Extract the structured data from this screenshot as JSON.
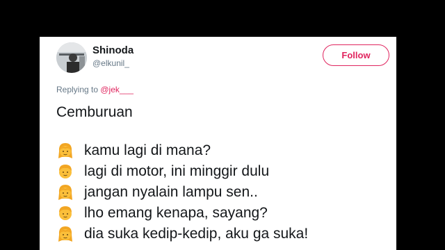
{
  "tweet": {
    "author_name": "Shinoda",
    "author_handle": "@elkunil_",
    "follow_label": "Follow",
    "reply_prefix": "Replying to ",
    "reply_to": "@jek___",
    "title": "Cemburuan",
    "lines": [
      {
        "emoji": "girl-emoji",
        "text": "kamu lagi di mana?"
      },
      {
        "emoji": "boy-emoji",
        "text": "lagi di motor, ini minggir dulu"
      },
      {
        "emoji": "girl-emoji",
        "text": "jangan nyalain lampu sen.."
      },
      {
        "emoji": "boy-emoji",
        "text": "lho emang kenapa, sayang?"
      },
      {
        "emoji": "girl-emoji",
        "text": "dia suka kedip-kedip, aku ga suka!"
      }
    ]
  },
  "colors": {
    "follow_accent": "#e0245e",
    "mention": "#e0245e",
    "muted_text": "#657786",
    "emoji_yellow": "#fbbf3a"
  }
}
